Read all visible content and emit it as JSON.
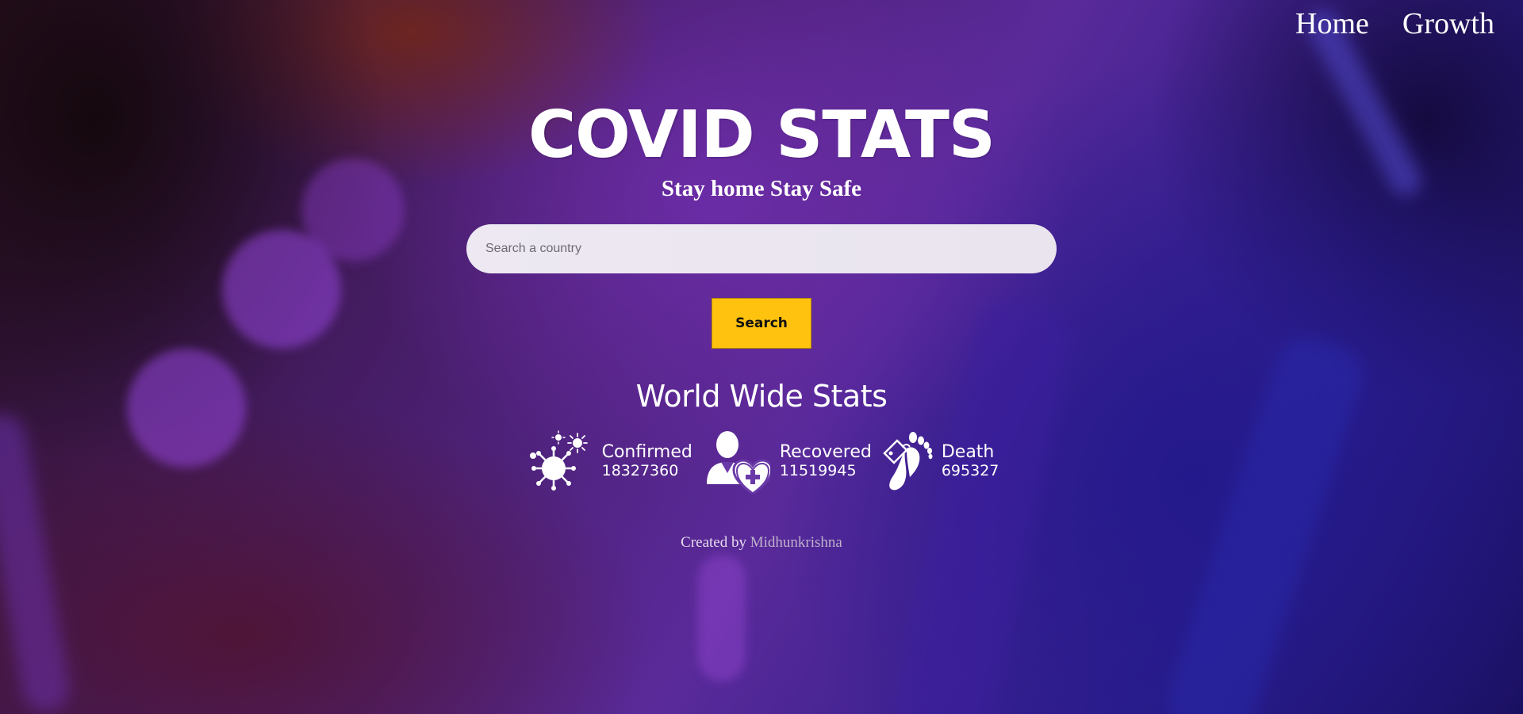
{
  "nav": {
    "home": "Home",
    "growth": "Growth"
  },
  "hero": {
    "title": "COVID STATS",
    "subtitle": "Stay home Stay Safe"
  },
  "search": {
    "placeholder": "Search a country",
    "value": "",
    "button_label": "Search"
  },
  "stats": {
    "heading": "World Wide Stats",
    "confirmed": {
      "label": "Confirmed",
      "value": "18327360",
      "icon": "virus-icon"
    },
    "recovered": {
      "label": "Recovered",
      "value": "11519945",
      "icon": "patient-heart-icon"
    },
    "death": {
      "label": "Death",
      "value": "695327",
      "icon": "toe-tag-foot-icon"
    }
  },
  "footer": {
    "credit_prefix": "Created by",
    "author": "Midhunkrishna"
  },
  "colors": {
    "accent": "#ffc20e",
    "text": "#ffffff",
    "input_bg": "#ede8f2"
  }
}
